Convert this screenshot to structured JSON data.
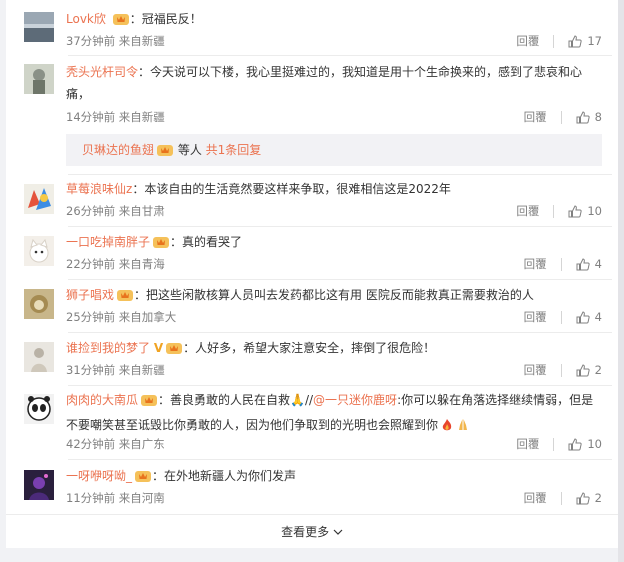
{
  "comments": [
    {
      "user": "Lovk欣",
      "text": "：冠福民反！",
      "time": "37分钟前 来自新疆",
      "reply": "回覆",
      "likes": "17"
    },
    {
      "user": "秃头光杆司令",
      "text": "：今天说可以下楼，我心里挺难过的，我知道是用十个生命换来的，感到了悲哀和心痛，",
      "time": "14分钟前 来自新疆",
      "reply": "回覆",
      "likes": "8",
      "subreply": {
        "user": "贝琳达的鱼翅",
        "mid": " 等人 ",
        "count": "共1条回复"
      }
    },
    {
      "user": "草莓浪味仙z",
      "text": "：本该自由的生活竟然要这样来争取，很难相信这是2022年",
      "time": "26分钟前 来自甘肃",
      "reply": "回覆",
      "likes": "10"
    },
    {
      "user": "一口吃掉南胖子",
      "text": "：真的看哭了",
      "time": "22分钟前 来自青海",
      "reply": "回覆",
      "likes": "4"
    },
    {
      "user": "狮子唱戏",
      "text": "：把这些闲散核算人员叫去发药都比这有用 医院反而能救真正需要救治的人",
      "time": "25分钟前 来自加拿大",
      "reply": "回覆",
      "likes": "4"
    },
    {
      "user": "谁捡到我的梦了",
      "vmark": "V",
      "text": "：人好多，希望大家注意安全，摔倒了很危险！",
      "time": "31分钟前 来自新疆",
      "reply": "回覆",
      "likes": "2"
    },
    {
      "user": "肉肉的大南瓜",
      "text": "：善良勇敢的人民在自救🙏//",
      "mention": "@一只迷你鹿呀",
      "text2": ":你可以躲在角落选择继续情弱，但是不要嘲笑甚至诋毁比你勇敢的人，因为他们争取到的光明也会照耀到你",
      "time": "42分钟前 来自广东",
      "reply": "回覆",
      "likes": "10"
    },
    {
      "user": "一呀咿呀呦_",
      "text": "：在外地新疆人为你们发声",
      "time": "11分钟前 来自河南",
      "reply": "回覆",
      "likes": "2"
    }
  ],
  "more_label": "查看更多",
  "colors": {
    "accent": "#eb7350",
    "meta": "#808080",
    "subreply_bg": "#f2f2f5"
  }
}
